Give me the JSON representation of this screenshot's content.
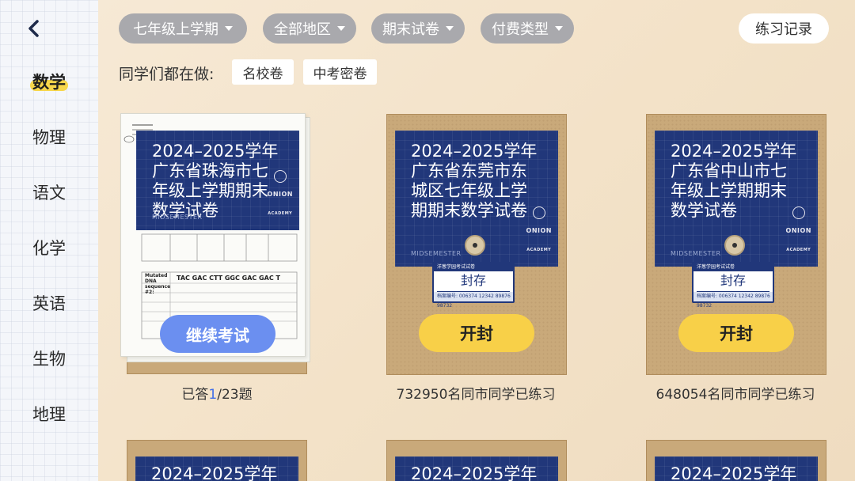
{
  "sidebar": {
    "back_label": "",
    "subjects": [
      {
        "label": "数学",
        "active": true
      },
      {
        "label": "物理",
        "active": false
      },
      {
        "label": "语文",
        "active": false
      },
      {
        "label": "化学",
        "active": false
      },
      {
        "label": "英语",
        "active": false
      },
      {
        "label": "生物",
        "active": false
      },
      {
        "label": "地理",
        "active": false
      }
    ]
  },
  "filters": {
    "grade": "七年级上学期",
    "region": "全部地区",
    "paper_type": "期末试卷",
    "payment_type": "付费类型"
  },
  "practice_record_label": "练习记录",
  "popular": {
    "label": "同学们都在做:",
    "tags": [
      "名校卷",
      "中考密卷"
    ]
  },
  "cards": [
    {
      "title": "2024–2025学年广东省珠海市七年级上学期期末数学试卷",
      "title_lines": [
        "2024–2025学年",
        "广东省珠海市七",
        "年级上学期期末",
        "数学试卷"
      ],
      "status": "in_progress",
      "action_label": "继续考试",
      "progress_prefix": "已答",
      "progress_current": "1",
      "progress_total": "/23题"
    },
    {
      "title": "2024–2025学年广东省东莞市东城区七年级上学期期末数学试卷",
      "title_lines": [
        "2024–2025学年",
        "广东省东莞市东",
        "城区七年级上学",
        "期期末数学试卷"
      ],
      "status": "sealed",
      "seal_label": "封存",
      "action_label": "开封",
      "caption": "732950名同市同学已练习"
    },
    {
      "title": "2024–2025学年广东省中山市七年级上学期期末数学试卷",
      "title_lines": [
        "2024–2025学年",
        "广东省中山市七",
        "年级上学期期末",
        "数学试卷"
      ],
      "status": "sealed",
      "seal_label": "封存",
      "action_label": "开封",
      "caption": "648054名同市同学已练习"
    }
  ],
  "cover_brand": "ONION",
  "cover_brand_sub": "ACADEMY",
  "cover_midsemester": "MIDSEMESTER",
  "seal_header": "洋葱学园考试试卷",
  "seal_serial": "档案编号: 006374 12342 89876 98732",
  "bottom_row_titles": [
    "2024–2025学年",
    "2024–2025学年",
    "2024–2025学年"
  ],
  "worksheet": {
    "dna_label": "Mutated DNA sequence #2:",
    "dna_seq": "TAC  GAC  CTT  GGC  GAC  GAC  T"
  },
  "colors": {
    "accent_yellow": "#f8d048",
    "accent_blue": "#6b8ff0",
    "cover_navy": "#21377a",
    "pill_gray": "#a9a9ad"
  }
}
